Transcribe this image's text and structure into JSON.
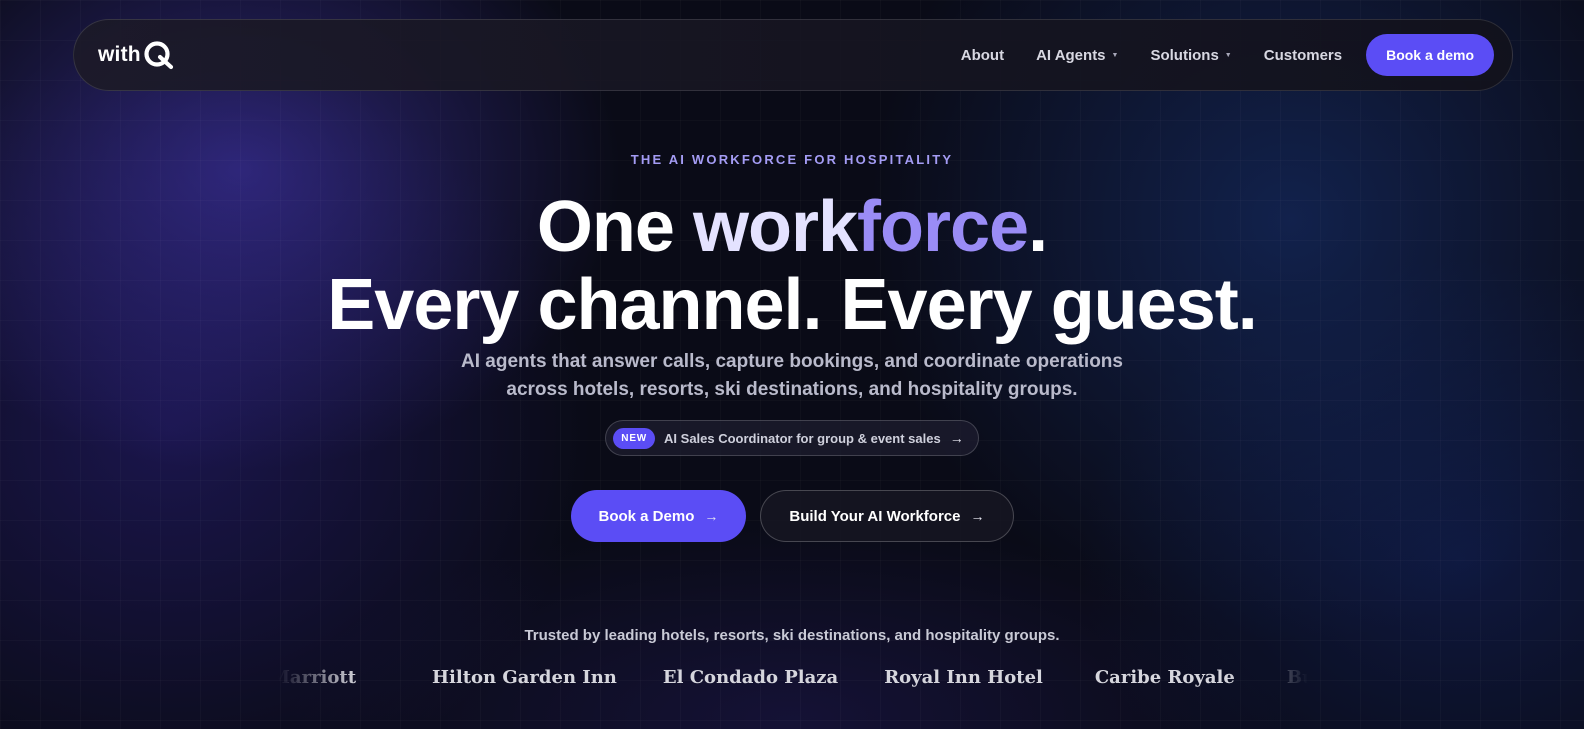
{
  "nav": {
    "logo_text": "with",
    "logo_mark": "Q",
    "links": [
      {
        "label": "About",
        "has_dropdown": false
      },
      {
        "label": "AI Agents",
        "has_dropdown": true
      },
      {
        "label": "Solutions",
        "has_dropdown": true
      },
      {
        "label": "Customers",
        "has_dropdown": false
      }
    ],
    "cta_label": "Book a demo"
  },
  "hero": {
    "eyebrow": "THE AI WORKFORCE FOR HOSPITALITY",
    "headline": {
      "line1_a": "One ",
      "line1_b": "work",
      "line1_c": "force",
      "line1_d": ".",
      "line2": "Every channel. Every guest."
    },
    "subtitle_line1": "AI agents that answer calls, capture bookings, and coordinate operations",
    "subtitle_line2": "across hotels, resorts, ski destinations, and hospitality groups.",
    "announcement": {
      "badge": "NEW",
      "text": "AI Sales Coordinator for group & event sales",
      "arrow": "→"
    },
    "primary_cta": {
      "label": "Book a Demo",
      "arrow": "→"
    },
    "secondary_cta": {
      "label": "Build Your AI Workforce",
      "arrow": "→"
    }
  },
  "trusted": {
    "caption": "Trusted by leading hotels, resorts, ski destinations, and hospitality groups.",
    "brands": [
      "Marriott",
      "Hilton Garden Inn",
      "El Condado Plaza",
      "Royal Inn Hotel",
      "Caribe Royale",
      "Buena Vista"
    ]
  },
  "colors": {
    "accent": "#5b4df5",
    "eyebrow": "#a49cf4",
    "background": "#0a0b17"
  }
}
